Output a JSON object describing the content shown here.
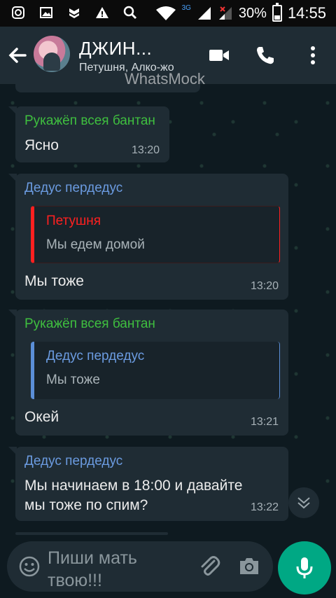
{
  "status_bar": {
    "battery": "30%",
    "time": "14:55",
    "network": "3G"
  },
  "header": {
    "title": "ДЖИН...",
    "subtitle": "Петушня, Алко-жо",
    "watermark": "WhatsMock"
  },
  "messages": [
    {
      "sender": "Рукажёп всея бантан",
      "sender_color": "#3fbf3f",
      "text": "Ясно",
      "time": "13:20"
    },
    {
      "sender": "Дедус пердедус",
      "sender_color": "#6b9be0",
      "quote": {
        "sender": "Петушня",
        "sender_color": "#ff2020",
        "text": "Мы едем домой"
      },
      "text": "Мы тоже",
      "time": "13:20"
    },
    {
      "sender": "Рукажёп всея бантан",
      "sender_color": "#3fbf3f",
      "quote": {
        "sender": "Дедус пердедус",
        "sender_color": "#6b9be0",
        "text": "Мы тоже"
      },
      "text": "Окей",
      "time": "13:21"
    },
    {
      "sender": "Дедус пердедус",
      "sender_color": "#6b9be0",
      "text_lines": [
        "Мы начинаем в 18:00 и давайте",
        "мы тоже по спим?"
      ],
      "time": "13:22"
    }
  ],
  "input": {
    "placeholder_lines": [
      "Пиши мать",
      "твою!!!"
    ]
  },
  "icons": [
    "instagram-icon",
    "image-icon",
    "shield-icon",
    "warning-icon",
    "search-icon",
    "wifi-icon",
    "signal-icon",
    "battery-icon",
    "back-arrow-icon",
    "video-call-icon",
    "phone-icon",
    "more-vertical-icon",
    "chevron-down-icon",
    "emoji-icon",
    "attach-icon",
    "camera-icon",
    "mic-icon"
  ],
  "colors": {
    "accent": "#00a884",
    "bubble": "#1f2c34",
    "header": "#1f2c34"
  }
}
